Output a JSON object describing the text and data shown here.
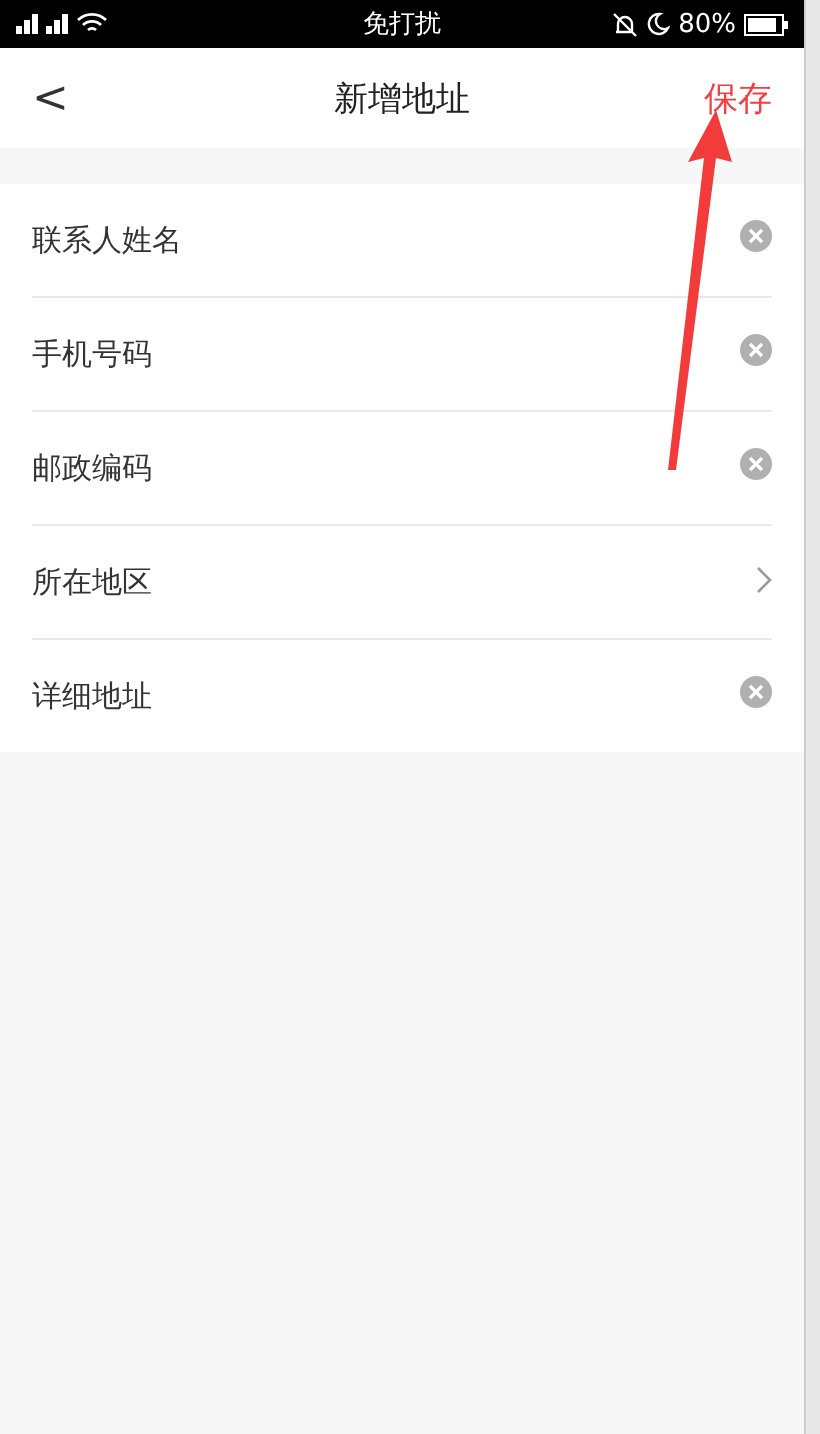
{
  "status_bar": {
    "center": "免打扰",
    "battery_text": "80%"
  },
  "nav_bar": {
    "back": "<",
    "title": "新增地址",
    "action": "保存"
  },
  "form_rows": [
    {
      "label": "联系人姓名",
      "kind": "clear"
    },
    {
      "label": "手机号码",
      "kind": "clear"
    },
    {
      "label": "邮政编码",
      "kind": "clear"
    },
    {
      "label": "所在地区",
      "kind": "chevron"
    },
    {
      "label": "详细地址",
      "kind": "clear"
    }
  ]
}
